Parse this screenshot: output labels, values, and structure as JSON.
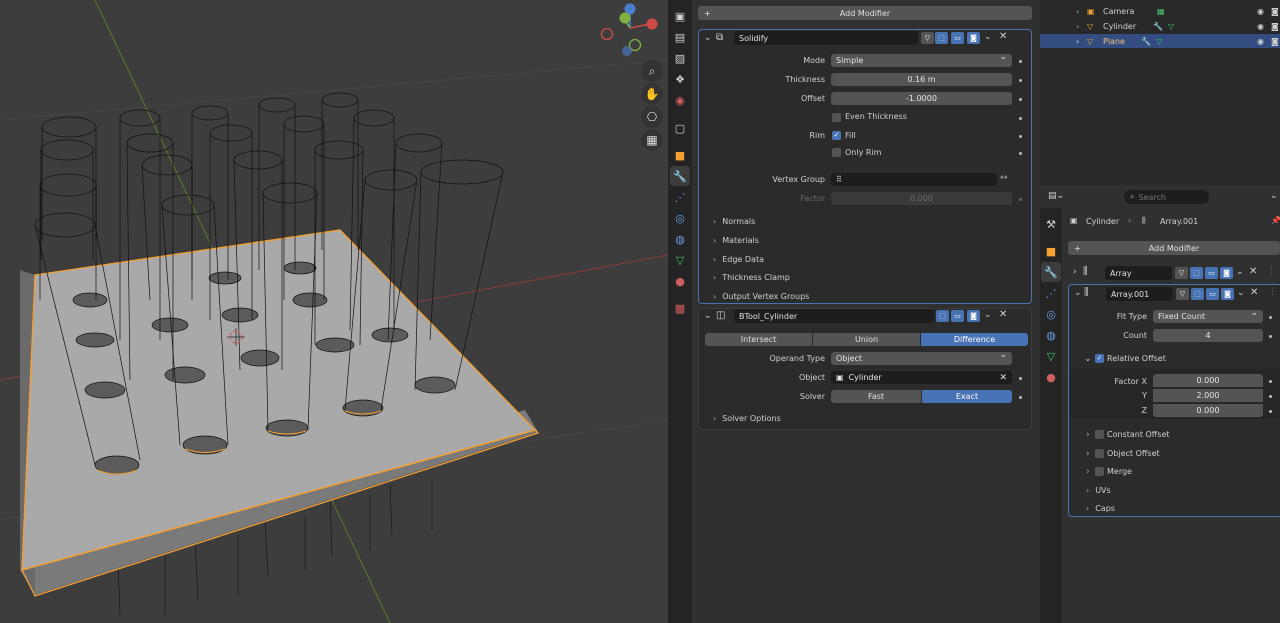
{
  "outliner": {
    "items": [
      {
        "label": "Camera",
        "selected": false
      },
      {
        "label": "Cylinder",
        "selected": false
      },
      {
        "label": "Plane",
        "selected": true
      }
    ]
  },
  "left_props": {
    "add_modifier": "Add Modifier",
    "solidify": {
      "name": "Solidify",
      "mode_label": "Mode",
      "mode_value": "Simple",
      "thickness_label": "Thickness",
      "thickness_value": "0.16 m",
      "offset_label": "Offset",
      "offset_value": "-1.0000",
      "even_thickness": "Even Thickness",
      "rim_label": "Rim",
      "fill": "Fill",
      "only_rim": "Only Rim",
      "vertex_group_label": "Vertex Group",
      "factor_label": "Factor",
      "factor_value": "0.000",
      "subpanels": [
        "Normals",
        "Materials",
        "Edge Data",
        "Thickness Clamp",
        "Output Vertex Groups"
      ]
    },
    "boolean": {
      "name": "BTool_Cylinder",
      "ops": [
        "Intersect",
        "Union",
        "Difference"
      ],
      "active_op": "Difference",
      "operand_type_label": "Operand Type",
      "operand_type_value": "Object",
      "object_label": "Object",
      "object_value": "Cylinder",
      "solver_label": "Solver",
      "solver_fast": "Fast",
      "solver_exact": "Exact",
      "solver_options": "Solver Options"
    }
  },
  "right_props": {
    "search_placeholder": "Search",
    "breadcrumb_object": "Cylinder",
    "breadcrumb_modifier": "Array.001",
    "add_modifier": "Add Modifier",
    "array1_name": "Array",
    "array2": {
      "name": "Array.001",
      "fit_type_label": "Fit Type",
      "fit_type_value": "Fixed Count",
      "count_label": "Count",
      "count_value": "4",
      "relative_offset": "Relative Offset",
      "factor_x_label": "Factor X",
      "factor_x_value": "0.000",
      "y_label": "Y",
      "y_value": "2.000",
      "z_label": "Z",
      "z_value": "0.000",
      "constant_offset": "Constant Offset",
      "object_offset": "Object Offset",
      "merge": "Merge",
      "uvs": "UVs",
      "caps": "Caps"
    }
  },
  "colors": {
    "accent": "#4772b3",
    "selection_outline": "#f5a033",
    "viewport_bg": "#3d3d3d"
  }
}
